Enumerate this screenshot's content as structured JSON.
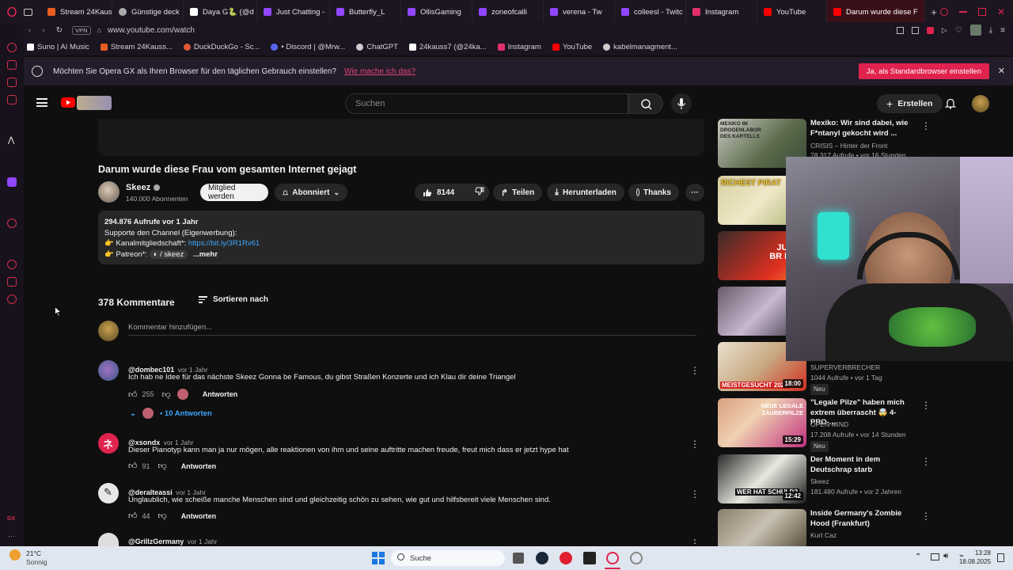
{
  "browser": {
    "tabs": [
      {
        "label": "Stream 24Kaus",
        "color": "#e85d20"
      },
      {
        "label": "Günstige deck",
        "color": "#aaaaaa"
      },
      {
        "label": "Daya G🐍 (@d",
        "color": "#ffffff"
      },
      {
        "label": "Just Chatting -",
        "color": "#9146ff"
      },
      {
        "label": "Butterfly_L",
        "color": "#9146ff"
      },
      {
        "label": "OllisGaming",
        "color": "#9146ff"
      },
      {
        "label": "zoneofcalli",
        "color": "#9146ff"
      },
      {
        "label": "verena - Tw",
        "color": "#9146ff"
      },
      {
        "label": "colleesl - Twitc",
        "color": "#9146ff"
      },
      {
        "label": "Instagram",
        "color": "#e1306c"
      },
      {
        "label": "YouTube",
        "color": "#ff0000"
      },
      {
        "label": "Darum wurde diese F",
        "color": "#ff0000"
      }
    ],
    "vpn": "VPN",
    "url": "www.youtube.com/watch",
    "bookmarks": [
      {
        "label": "Suno | AI Music",
        "color": "#ffffff"
      },
      {
        "label": "Stream 24Kauss...",
        "color": "#e85d20"
      },
      {
        "label": "DuckDuckGo - Sc...",
        "color": "#de5833"
      },
      {
        "label": "• Discord | @Mrw...",
        "color": "#5865f2"
      },
      {
        "label": "ChatGPT",
        "color": "#cccccc"
      },
      {
        "label": "24kauss7 (@24ka...",
        "color": "#ffffff"
      },
      {
        "label": "Instagram",
        "color": "#e1306c"
      },
      {
        "label": "YouTube",
        "color": "#ff0000"
      },
      {
        "label": "kabelmanagment...",
        "color": "#cccccc"
      }
    ],
    "banner": {
      "text": "Möchten Sie Opera GX als Ihren Browser für den täglichen Gebrauch einstellen?",
      "link": "Wie mache ich das?",
      "button": "Ja, als Standardbrowser einstellen"
    }
  },
  "youtube": {
    "search_placeholder": "Suchen",
    "create_label": "Erstellen",
    "video_title": "Darum wurde diese Frau vom gesamten Internet gejagt",
    "channel": {
      "name": "Skeez",
      "subscribers": "140.000 Abonnenten"
    },
    "member_label": "Mitglied werden",
    "subscribed_label": "Abonniert",
    "likes": "8144",
    "share_label": "Teilen",
    "download_label": "Herunterladen",
    "thanks_label": "Thanks",
    "description": {
      "stats": "294.876 Aufrufe  vor 1 Jahr",
      "line1": "Supporte den Channel (Eigenwerbung):",
      "line2_label": "Kanalmitgliedschaft*:",
      "line2_link": "https://bit.ly/3R1Rv61",
      "line3_label": "Patreon*:",
      "line3_value": "/ skeez",
      "more": "...mehr"
    },
    "comments_count": "378 Kommentare",
    "sort_label": "Sortieren nach",
    "add_comment_placeholder": "Kommentar hinzufügen...",
    "reply_label": "Antworten",
    "comments": [
      {
        "author": "@dombec101",
        "time": "vor 1 Jahr",
        "text": "Ich hab ne Idee für das nächste Skeez Gonna be Famous, du gibst Straßen Konzerte und ich Klau dir deine Triangel",
        "likes": "255",
        "replies": "• 10 Antworten"
      },
      {
        "author": "@xsondx",
        "time": "vor 1 Jahr",
        "text": "Dieser Pianotyp kann man ja nur mögen, alle reaktionen von ihm und seine auftritte machen freude,  freut mich dass er jetzt hype hat",
        "likes": "91"
      },
      {
        "author": "@deralteassi",
        "time": "vor 1 Jahr",
        "text": "Unglaublich, wie scheiße manche Menschen sind und gleichzeitig schön zu sehen, wie gut und hilfsbereit viele Menschen sind.",
        "likes": "44"
      },
      {
        "author": "@GrillzGermany",
        "time": "vor 1 Jahr"
      }
    ],
    "recommendations": [
      {
        "title": "Mexiko: Wir sind dabei, wie F*ntanyl gekocht wird ...",
        "channel": "CRISIS – Hinter der Front",
        "meta": "78.317 Aufrufe • vor 16 Stunden",
        "thumb_text": "MEXIKO IM DROGENLABOR DES KARTELLS"
      },
      {
        "title": "",
        "channel": "",
        "meta": "",
        "thumb_text": "RICHEST PIRAT"
      },
      {
        "title": "",
        "channel": "",
        "meta": "",
        "thumb_text": "JUNG. BR BÖS"
      },
      {
        "title": "",
        "channel": "",
        "meta": "",
        "thumb_text": ""
      },
      {
        "title": "",
        "channel": "SUPERVERBRECHER",
        "meta": "1044 Aufrufe • vor 1 Tag",
        "badge": "Neu",
        "thumb_text": "MEISTGESUCHT 2025",
        "duration": "18:00"
      },
      {
        "title": "\"Legale Pilze\" haben mich extrem überrascht 🤯 4-PRO-...",
        "channel": "OPEN MIND",
        "meta": "17.208 Aufrufe • vor 14 Stunden",
        "badge": "Neu",
        "thumb_text": "NEUE LEGALE ZAUBERPILZE",
        "duration": "15:29"
      },
      {
        "title": "Der Moment in dem Deutschrap starb",
        "channel": "Skeez",
        "meta": "181.480 Aufrufe • vor 2 Jahren",
        "thumb_text": "WER HAT SCHULD?",
        "duration": "12:42"
      },
      {
        "title": "Inside Germany's Zombie Hood (Frankfurt)",
        "channel": "Kurt Caz",
        "meta": "",
        "thumb_text": ""
      }
    ]
  },
  "taskbar": {
    "weather_temp": "21°C",
    "weather_desc": "Sonnig",
    "search": "Suche",
    "time": "13:28",
    "date": "18.08.2025"
  },
  "colors": {
    "accent": "#e0234e",
    "link": "#3ea6ff",
    "yt_red": "#ff0000"
  }
}
